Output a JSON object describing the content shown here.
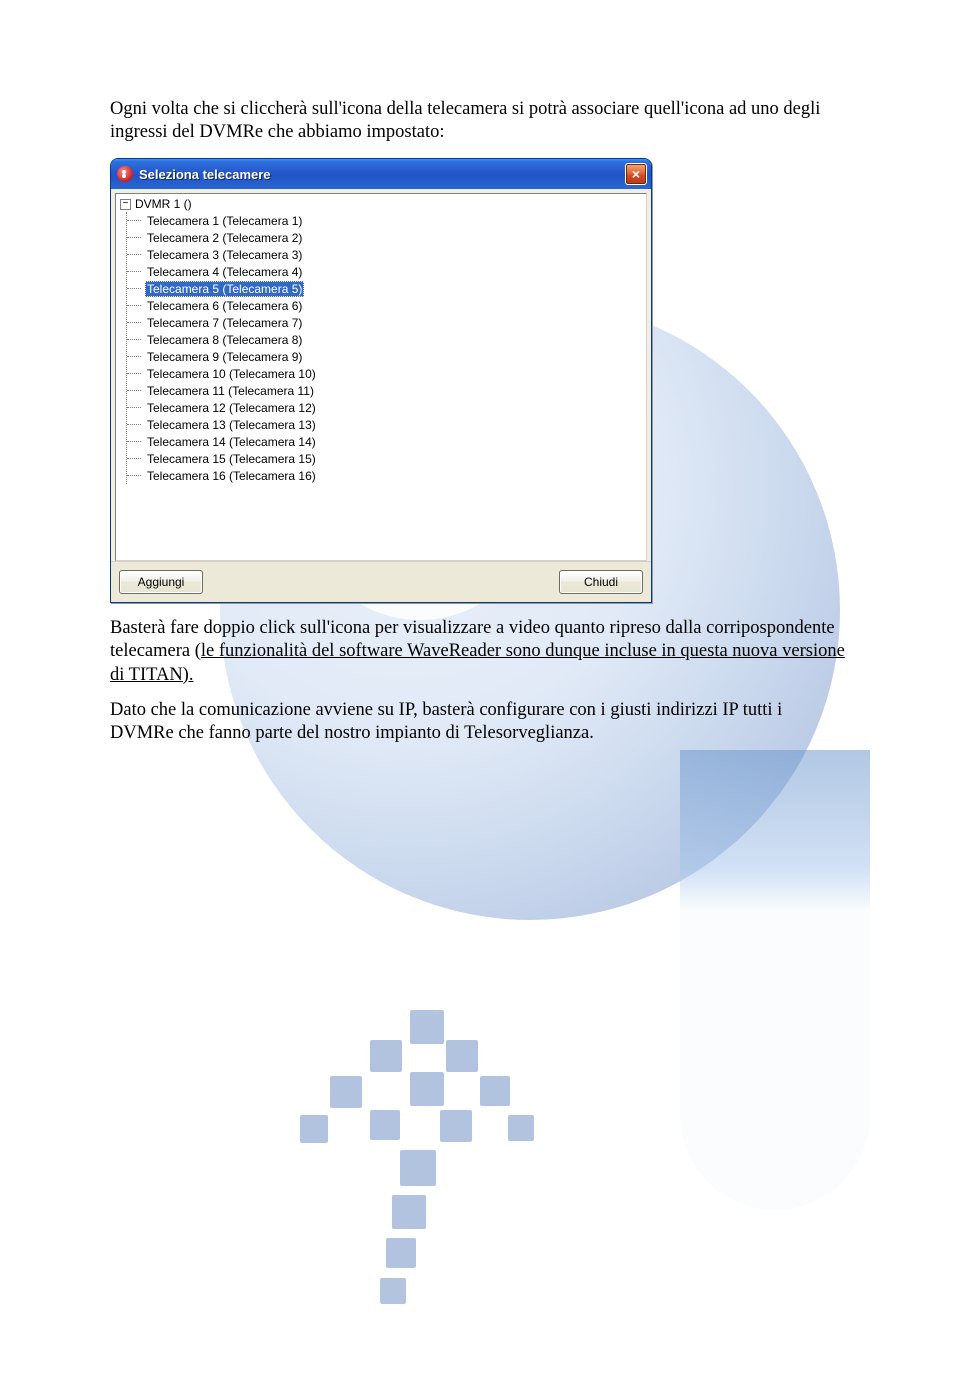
{
  "paragraph_top": "Ogni volta che si cliccherà sull'icona della telecamera si potrà associare quell'icona ad uno degli ingressi del DVMRe che abbiamo impostato:",
  "dialog": {
    "title": "Seleziona telecamere",
    "root_label": "DVMR 1 ()",
    "toggle_symbol": "−",
    "selected_index": 4,
    "items": [
      "Telecamera 1 (Telecamera 1)",
      "Telecamera 2 (Telecamera 2)",
      "Telecamera 3 (Telecamera 3)",
      "Telecamera 4 (Telecamera 4)",
      "Telecamera 5 (Telecamera 5)",
      "Telecamera 6 (Telecamera 6)",
      "Telecamera 7 (Telecamera 7)",
      "Telecamera 8 (Telecamera 8)",
      "Telecamera 9 (Telecamera 9)",
      "Telecamera 10 (Telecamera 10)",
      "Telecamera 11 (Telecamera 11)",
      "Telecamera 12 (Telecamera 12)",
      "Telecamera 13 (Telecamera 13)",
      "Telecamera 14 (Telecamera 14)",
      "Telecamera 15 (Telecamera 15)",
      "Telecamera 16 (Telecamera 16)"
    ],
    "btn_add": "Aggiungi",
    "btn_close": "Chiudi"
  },
  "paragraph_mid": "Basterà fare doppio click sull'icona per visualizzare a video quanto ripreso dalla corripospondente telecamera (",
  "paragraph_mid_underline": "le funzionalità del software WaveReader sono dunque incluse in questa nuova versione di TITAN).",
  "paragraph_bottom": "Dato che la comunicazione avviene su IP, basterà configurare con i giusti indirizzi IP tutti i DVMRe che fanno parte del nostro impianto di Telesorveglianza."
}
